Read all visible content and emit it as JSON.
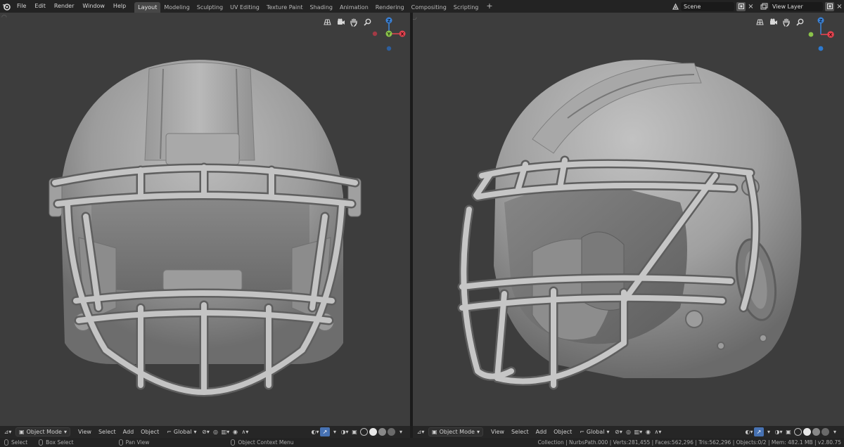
{
  "menu": [
    "File",
    "Edit",
    "Render",
    "Window",
    "Help"
  ],
  "workspaces": [
    "Layout",
    "Modeling",
    "Sculpting",
    "UV Editing",
    "Texture Paint",
    "Shading",
    "Animation",
    "Rendering",
    "Compositing",
    "Scripting"
  ],
  "active_workspace": "Layout",
  "add_workspace": "+",
  "scene": {
    "name": "Scene"
  },
  "view_layer": {
    "name": "View Layer"
  },
  "left_viewport": {
    "view": "Front",
    "gizmo": {
      "up": "Z",
      "front": "Y",
      "right": "X"
    }
  },
  "right_viewport": {
    "view": "Perspective",
    "gizmo": {
      "up": "Z",
      "right": "X"
    }
  },
  "header": {
    "mode": "Object Mode",
    "view": "View",
    "select": "Select",
    "add": "Add",
    "object": "Object",
    "orientation": "Global"
  },
  "status": {
    "select": "Select",
    "box_select": "Box Select",
    "pan_view": "Pan View",
    "context_menu": "Object Context Menu",
    "stats": "Collection | NurbsPath.000 | Verts:281,455 | Faces:562,296 | Tris:562,296 | Objects:0/2 | Mem: 482.1 MB | v2.80.75"
  },
  "colors": {
    "viewport_bg": "#3d3d3d",
    "axis_x": "#e4434f",
    "axis_y": "#8bc34a",
    "axis_z": "#3b82d6",
    "accent": "#4772b3"
  }
}
